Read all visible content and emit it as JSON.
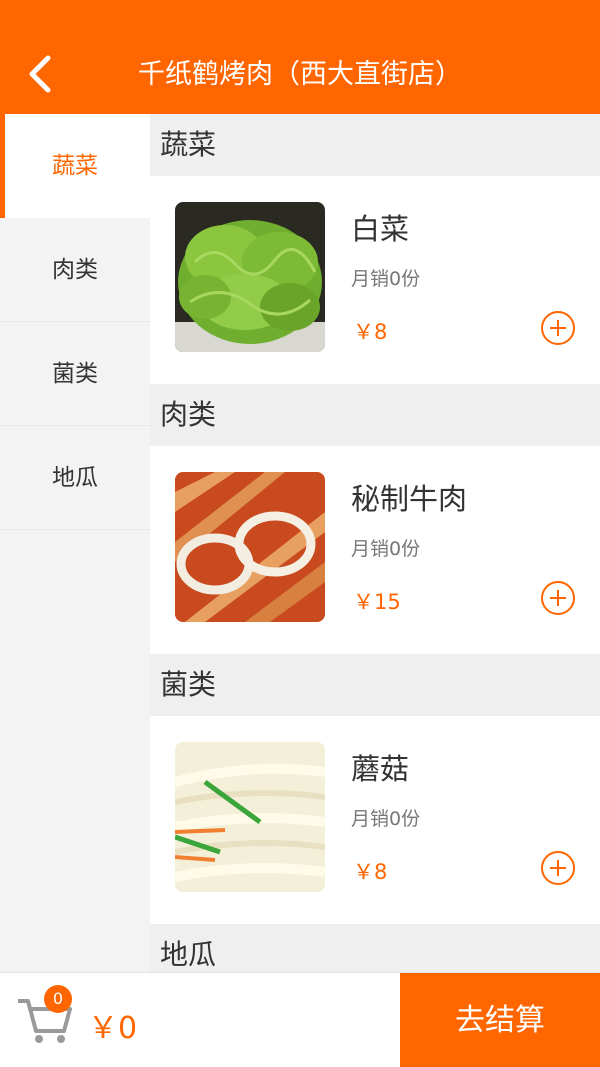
{
  "header": {
    "title": "千纸鹤烤肉（西大直街店）",
    "back_icon": "chevron-left-icon"
  },
  "colors": {
    "accent": "#ff6600",
    "sidebar_bg": "#f3f3f3",
    "section_bg": "#efefef"
  },
  "sidebar": {
    "items": [
      {
        "label": "蔬菜",
        "active": true
      },
      {
        "label": "肉类",
        "active": false
      },
      {
        "label": "菌类",
        "active": false
      },
      {
        "label": "地瓜",
        "active": false
      }
    ]
  },
  "sections": [
    {
      "title": "蔬菜",
      "items": [
        {
          "name": "白菜",
          "sales": "月销0份",
          "price": "￥8",
          "image": "lettuce"
        }
      ]
    },
    {
      "title": "肉类",
      "items": [
        {
          "name": "秘制牛肉",
          "sales": "月销0份",
          "price": "￥15",
          "image": "marinated-beef"
        }
      ]
    },
    {
      "title": "菌类",
      "items": [
        {
          "name": "蘑菇",
          "sales": "月销0份",
          "price": "￥8",
          "image": "enoki-mushroom"
        }
      ]
    },
    {
      "title": "地瓜",
      "items": []
    }
  ],
  "footer": {
    "cart_icon": "shopping-cart-icon",
    "cart_count": "0",
    "total": "￥0",
    "checkout_label": "去结算"
  }
}
